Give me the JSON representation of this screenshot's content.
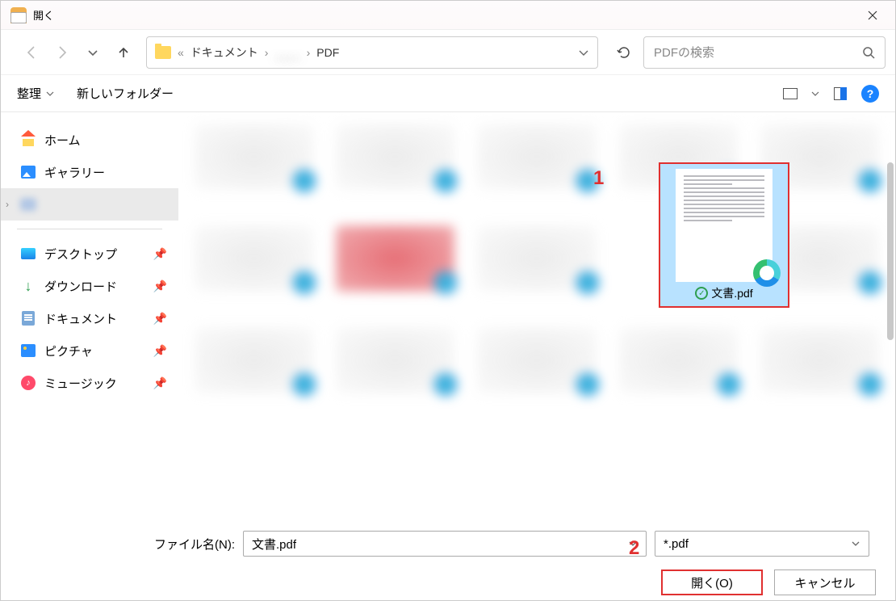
{
  "title": "開く",
  "breadcrumb": {
    "root_sep": "«",
    "item1": "ドキュメント",
    "item2_blur": "____",
    "item3": "PDF"
  },
  "search": {
    "placeholder": "PDFの検索"
  },
  "toolbar": {
    "organize": "整理",
    "new_folder": "新しいフォルダー"
  },
  "sidebar": {
    "home": "ホーム",
    "gallery": "ギャラリー",
    "selected_blur": "",
    "desktop": "デスクトップ",
    "downloads": "ダウンロード",
    "documents": "ドキュメント",
    "pictures": "ピクチャ",
    "music": "ミュージック"
  },
  "selected_file": {
    "name": "文書.pdf"
  },
  "footer": {
    "filename_label": "ファイル名(N):",
    "filename_value": "文書.pdf",
    "filter_value": "*.pdf",
    "open_btn": "開く(O)",
    "cancel_btn": "キャンセル"
  },
  "annotations": {
    "n1": "1",
    "n2": "2"
  }
}
